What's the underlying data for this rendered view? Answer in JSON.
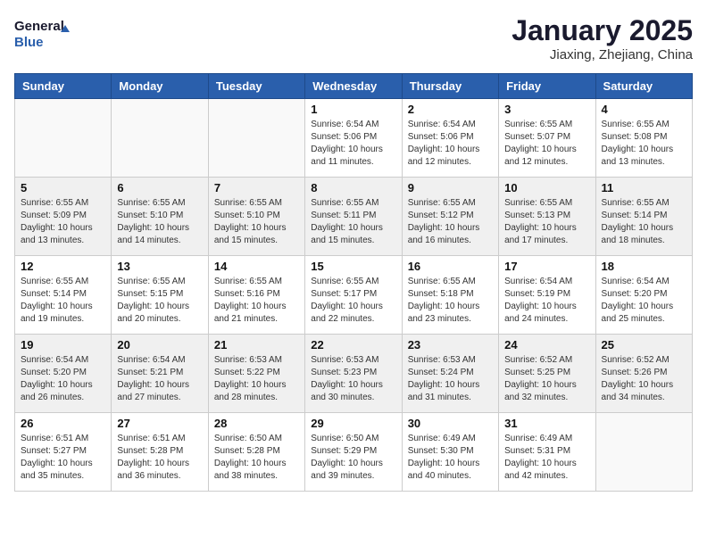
{
  "header": {
    "logo_line1": "General",
    "logo_line2": "Blue",
    "month_title": "January 2025",
    "location": "Jiaxing, Zhejiang, China"
  },
  "days_of_week": [
    "Sunday",
    "Monday",
    "Tuesday",
    "Wednesday",
    "Thursday",
    "Friday",
    "Saturday"
  ],
  "weeks": [
    [
      {
        "day": "",
        "info": ""
      },
      {
        "day": "",
        "info": ""
      },
      {
        "day": "",
        "info": ""
      },
      {
        "day": "1",
        "info": "Sunrise: 6:54 AM\nSunset: 5:06 PM\nDaylight: 10 hours\nand 11 minutes."
      },
      {
        "day": "2",
        "info": "Sunrise: 6:54 AM\nSunset: 5:06 PM\nDaylight: 10 hours\nand 12 minutes."
      },
      {
        "day": "3",
        "info": "Sunrise: 6:55 AM\nSunset: 5:07 PM\nDaylight: 10 hours\nand 12 minutes."
      },
      {
        "day": "4",
        "info": "Sunrise: 6:55 AM\nSunset: 5:08 PM\nDaylight: 10 hours\nand 13 minutes."
      }
    ],
    [
      {
        "day": "5",
        "info": "Sunrise: 6:55 AM\nSunset: 5:09 PM\nDaylight: 10 hours\nand 13 minutes."
      },
      {
        "day": "6",
        "info": "Sunrise: 6:55 AM\nSunset: 5:10 PM\nDaylight: 10 hours\nand 14 minutes."
      },
      {
        "day": "7",
        "info": "Sunrise: 6:55 AM\nSunset: 5:10 PM\nDaylight: 10 hours\nand 15 minutes."
      },
      {
        "day": "8",
        "info": "Sunrise: 6:55 AM\nSunset: 5:11 PM\nDaylight: 10 hours\nand 15 minutes."
      },
      {
        "day": "9",
        "info": "Sunrise: 6:55 AM\nSunset: 5:12 PM\nDaylight: 10 hours\nand 16 minutes."
      },
      {
        "day": "10",
        "info": "Sunrise: 6:55 AM\nSunset: 5:13 PM\nDaylight: 10 hours\nand 17 minutes."
      },
      {
        "day": "11",
        "info": "Sunrise: 6:55 AM\nSunset: 5:14 PM\nDaylight: 10 hours\nand 18 minutes."
      }
    ],
    [
      {
        "day": "12",
        "info": "Sunrise: 6:55 AM\nSunset: 5:14 PM\nDaylight: 10 hours\nand 19 minutes."
      },
      {
        "day": "13",
        "info": "Sunrise: 6:55 AM\nSunset: 5:15 PM\nDaylight: 10 hours\nand 20 minutes."
      },
      {
        "day": "14",
        "info": "Sunrise: 6:55 AM\nSunset: 5:16 PM\nDaylight: 10 hours\nand 21 minutes."
      },
      {
        "day": "15",
        "info": "Sunrise: 6:55 AM\nSunset: 5:17 PM\nDaylight: 10 hours\nand 22 minutes."
      },
      {
        "day": "16",
        "info": "Sunrise: 6:55 AM\nSunset: 5:18 PM\nDaylight: 10 hours\nand 23 minutes."
      },
      {
        "day": "17",
        "info": "Sunrise: 6:54 AM\nSunset: 5:19 PM\nDaylight: 10 hours\nand 24 minutes."
      },
      {
        "day": "18",
        "info": "Sunrise: 6:54 AM\nSunset: 5:20 PM\nDaylight: 10 hours\nand 25 minutes."
      }
    ],
    [
      {
        "day": "19",
        "info": "Sunrise: 6:54 AM\nSunset: 5:20 PM\nDaylight: 10 hours\nand 26 minutes."
      },
      {
        "day": "20",
        "info": "Sunrise: 6:54 AM\nSunset: 5:21 PM\nDaylight: 10 hours\nand 27 minutes."
      },
      {
        "day": "21",
        "info": "Sunrise: 6:53 AM\nSunset: 5:22 PM\nDaylight: 10 hours\nand 28 minutes."
      },
      {
        "day": "22",
        "info": "Sunrise: 6:53 AM\nSunset: 5:23 PM\nDaylight: 10 hours\nand 30 minutes."
      },
      {
        "day": "23",
        "info": "Sunrise: 6:53 AM\nSunset: 5:24 PM\nDaylight: 10 hours\nand 31 minutes."
      },
      {
        "day": "24",
        "info": "Sunrise: 6:52 AM\nSunset: 5:25 PM\nDaylight: 10 hours\nand 32 minutes."
      },
      {
        "day": "25",
        "info": "Sunrise: 6:52 AM\nSunset: 5:26 PM\nDaylight: 10 hours\nand 34 minutes."
      }
    ],
    [
      {
        "day": "26",
        "info": "Sunrise: 6:51 AM\nSunset: 5:27 PM\nDaylight: 10 hours\nand 35 minutes."
      },
      {
        "day": "27",
        "info": "Sunrise: 6:51 AM\nSunset: 5:28 PM\nDaylight: 10 hours\nand 36 minutes."
      },
      {
        "day": "28",
        "info": "Sunrise: 6:50 AM\nSunset: 5:28 PM\nDaylight: 10 hours\nand 38 minutes."
      },
      {
        "day": "29",
        "info": "Sunrise: 6:50 AM\nSunset: 5:29 PM\nDaylight: 10 hours\nand 39 minutes."
      },
      {
        "day": "30",
        "info": "Sunrise: 6:49 AM\nSunset: 5:30 PM\nDaylight: 10 hours\nand 40 minutes."
      },
      {
        "day": "31",
        "info": "Sunrise: 6:49 AM\nSunset: 5:31 PM\nDaylight: 10 hours\nand 42 minutes."
      },
      {
        "day": "",
        "info": ""
      }
    ]
  ]
}
